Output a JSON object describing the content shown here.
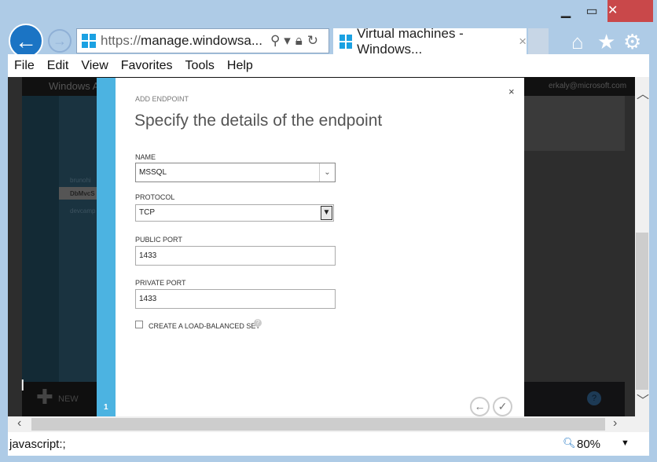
{
  "browser": {
    "url_prefix": "https://",
    "url_host": "manage.windowsa...",
    "tab_title": "Virtual machines - Windows...",
    "tab_close": "×"
  },
  "menu": [
    "File",
    "Edit",
    "View",
    "Favorites",
    "Tools",
    "Help"
  ],
  "background": {
    "brand": "Windows A",
    "user": "erkaly@microsoft.com",
    "list": [
      "brunohi",
      "DbMvcS",
      "devcamp"
    ],
    "new_label": "NEW",
    "help": "?"
  },
  "dialog": {
    "section": "ADD ENDPOINT",
    "title": "Specify the details of the endpoint",
    "close": "×",
    "step": "1",
    "name_label": "NAME",
    "name_value": "MSSQL",
    "protocol_label": "PROTOCOL",
    "protocol_value": "TCP",
    "public_port_label": "PUBLIC PORT",
    "public_port_value": "1433",
    "private_port_label": "PRIVATE PORT",
    "private_port_value": "1433",
    "lb_label": "CREATE A LOAD-BALANCED SET",
    "lb_help": "?"
  },
  "status": {
    "text": "javascript:;",
    "zoom": "80%"
  }
}
